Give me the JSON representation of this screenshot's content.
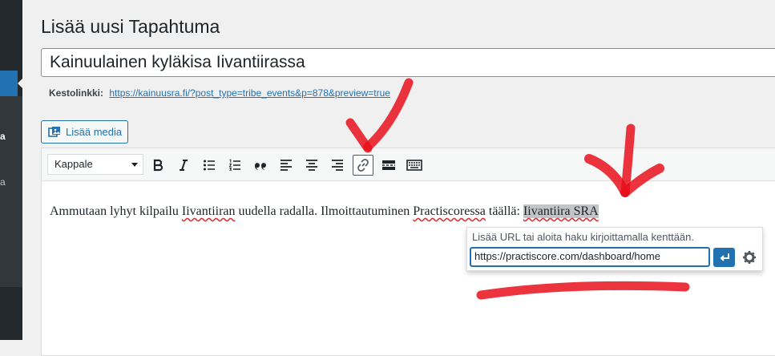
{
  "sidebar": {
    "item_a": "a",
    "item_b": "a"
  },
  "page": {
    "title": "Lisää uusi Tapahtuma"
  },
  "post": {
    "title": "Kainuulainen kyläkisa Iivantiirassa"
  },
  "permalink": {
    "label": "Kestolinkki:",
    "url": "https://kainuusra.fi/?post_type=tribe_events&p=878&preview=true"
  },
  "media": {
    "button_label": "Lisää media"
  },
  "toolbar": {
    "format_value": "Kappale",
    "buttons": [
      "bold",
      "italic",
      "bullet-list",
      "numbered-list",
      "blockquote",
      "align-left",
      "align-center",
      "align-right",
      "insert-link",
      "read-more",
      "toolbar-toggle"
    ]
  },
  "content": {
    "part1": "Ammutaan lyhyt kilpailu ",
    "word1": "Iivantiiran",
    "part2": " uudella radalla. Ilmoittautuminen ",
    "word2": "Practiscoressa",
    "part3": " täällä: ",
    "link_text": "Iivantiira SRA"
  },
  "link_popup": {
    "hint": "Lisää URL tai aloita haku kirjoittamalla kenttään.",
    "url_value": "https://practiscore.com/dashboard/home"
  },
  "colors": {
    "accent": "#2271b1",
    "sidebar": "#23282d",
    "annotation": "#e8101b"
  }
}
